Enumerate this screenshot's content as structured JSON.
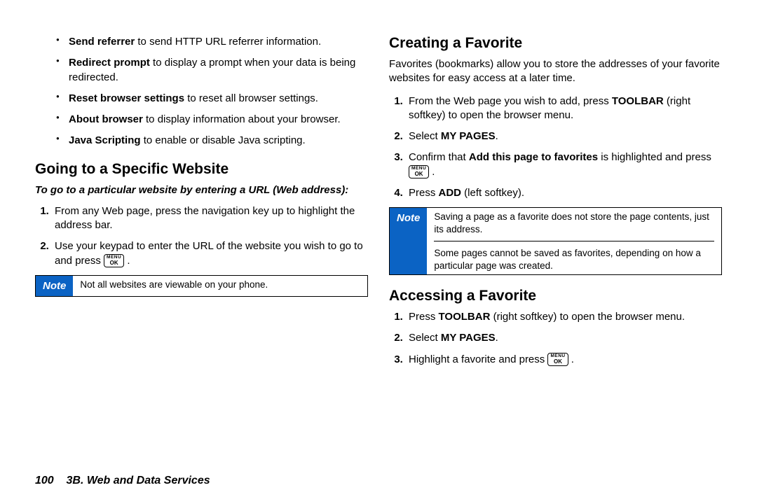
{
  "left": {
    "bullets": [
      {
        "term": "Send referrer",
        "rest": " to send HTTP URL referrer information."
      },
      {
        "term": "Redirect prompt",
        "rest": " to display a prompt when your data is being redirected."
      },
      {
        "term": "Reset browser settings",
        "rest": " to reset all browser settings."
      },
      {
        "term": "About browser",
        "rest": " to display information about your browser."
      },
      {
        "term": "Java Scripting",
        "rest": " to enable or disable Java scripting."
      }
    ],
    "heading": "Going to a Specific Website",
    "intro": "To go to a particular website by entering a URL (Web address):",
    "steps": [
      "From any Web page, press the navigation key up to highlight the address bar.",
      "Use your keypad to enter the URL of the website you wish to go to and press "
    ],
    "note": {
      "label": "Note",
      "text": "Not all websites are viewable on your phone."
    }
  },
  "right": {
    "heading1": "Creating a Favorite",
    "intro1": "Favorites (bookmarks) allow you to store the addresses of your favorite websites for easy access at a later time.",
    "steps1": {
      "s1a": "From the Web page you wish to add, press ",
      "s1b": "TOOLBAR",
      "s1c": " (right softkey) to open the browser menu.",
      "s2a": "Select ",
      "s2b": "MY PAGES",
      "s2c": ".",
      "s3a": "Confirm that ",
      "s3b": "Add this page to favorites",
      "s3c": " is highlighted and press ",
      "s4a": "Press ",
      "s4b": "ADD",
      "s4c": " (left softkey)."
    },
    "note": {
      "label": "Note",
      "p1": "Saving a page as a favorite does not store the page contents, just its address.",
      "p2": "Some pages cannot be saved as favorites, depending on how a particular page was created."
    },
    "heading2": "Accessing a Favorite",
    "steps2": {
      "s1a": "Press ",
      "s1b": "TOOLBAR",
      "s1c": " (right softkey) to open the browser menu.",
      "s2a": "Select ",
      "s2b": "MY PAGES",
      "s2c": ".",
      "s3a": "Highlight a favorite and press "
    }
  },
  "footer": {
    "page": "100",
    "section": "3B. Web and Data Services"
  },
  "ok_key": {
    "top": "MENU",
    "bot": "OK"
  }
}
